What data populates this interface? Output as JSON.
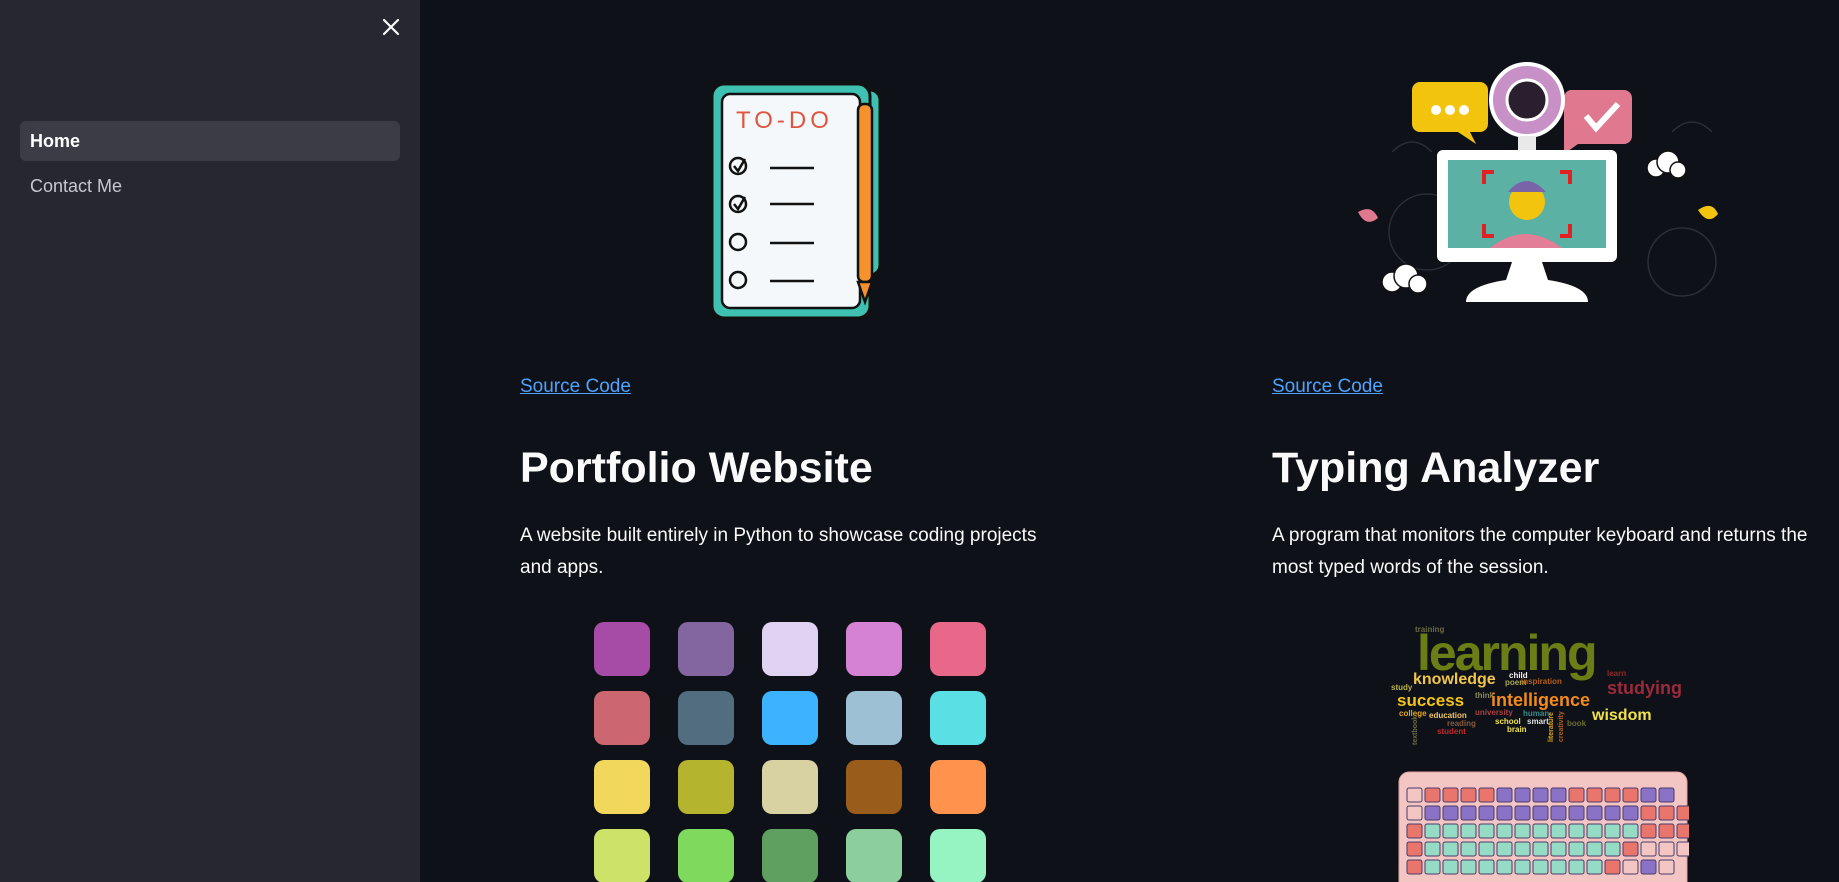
{
  "sidebar": {
    "close_label": "Close sidebar",
    "items": [
      {
        "label": "Home",
        "active": true
      },
      {
        "label": "Contact Me",
        "active": false
      }
    ]
  },
  "projects": [
    {
      "image_icon": "todo-list-illustration",
      "link_label": "Source Code",
      "title": "Portfolio Website",
      "description": "A website built entirely in Python to showcase coding projects and apps."
    },
    {
      "image_icon": "webcam-monitor-illustration",
      "link_label": "Source Code",
      "title": "Typing Analyzer",
      "description": "A program that monitors the computer keyboard and returns the most typed words of the session."
    }
  ],
  "wordcloud": {
    "words": [
      "learning",
      "knowledge",
      "success",
      "intelligence",
      "wisdom",
      "studying",
      "education",
      "school",
      "student",
      "brain",
      "smart",
      "college",
      "reading",
      "human",
      "university",
      "book",
      "think",
      "child",
      "inspiration",
      "training",
      "study",
      "learn",
      "poem",
      "creativity",
      "literature",
      "teacher"
    ]
  },
  "colors": {
    "background": "#0e1117",
    "sidebar": "#262730",
    "link": "#4da3ff",
    "swatches": [
      "#a64ca6",
      "#8366a0",
      "#e0d3f2",
      "#d682d4",
      "#e9688a",
      "#cc6670",
      "#526d80",
      "#3db3ff",
      "#9ec0d4",
      "#5ae0e4",
      "#f1d85c",
      "#b4b42e",
      "#d8d1a1",
      "#995c1a",
      "#ff924d",
      "#cde269",
      "#7ed95c",
      "#5fa060",
      "#8ccf9d",
      "#95f4c2"
    ]
  }
}
